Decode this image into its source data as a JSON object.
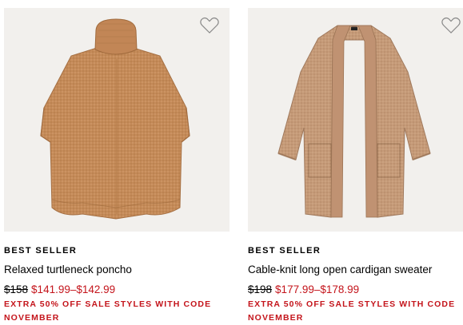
{
  "products": [
    {
      "badge": "BEST SELLER",
      "name": "Relaxed turtleneck poncho",
      "price_original": "$158",
      "price_sale": "$141.99–$142.99",
      "promo_line1": "EXTRA 50% OFF SALE STYLES WITH CODE",
      "promo_line2": "NOVEMBER",
      "image_icon": "poncho-image",
      "wishlist_icon": "heart-outline-icon"
    },
    {
      "badge": "BEST SELLER",
      "name": "Cable-knit long open cardigan sweater",
      "price_original": "$198",
      "price_sale": "$177.99–$178.99",
      "promo_line1": "EXTRA 50% OFF SALE STYLES WITH CODE",
      "promo_line2": "NOVEMBER",
      "image_icon": "cardigan-image",
      "wishlist_icon": "heart-outline-icon"
    }
  ],
  "colors": {
    "sale_red": "#c4141b",
    "image_bg": "#f2f0ed",
    "poncho_knit": "#c48a58",
    "cardigan_knit": "#c59a78"
  }
}
